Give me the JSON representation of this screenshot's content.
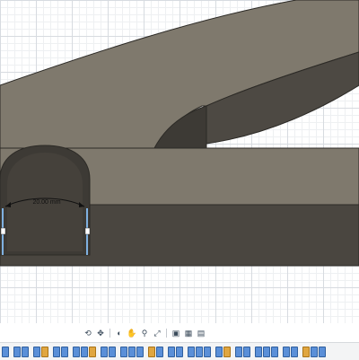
{
  "dimension": {
    "value": "20.00 mm"
  },
  "toolbar": {
    "icons": [
      "orbit-icon",
      "pan-icon",
      "look-at-icon",
      "zoom-icon",
      "fit-icon",
      "display-settings-icon",
      "grid-settings-icon",
      "viewports-icon"
    ]
  },
  "colors": {
    "body_top": "#7e786c",
    "body_side": "#4a4640",
    "inner": "#3a3833",
    "edge": "#2c2a26",
    "highlight": "#7fb0e0"
  }
}
